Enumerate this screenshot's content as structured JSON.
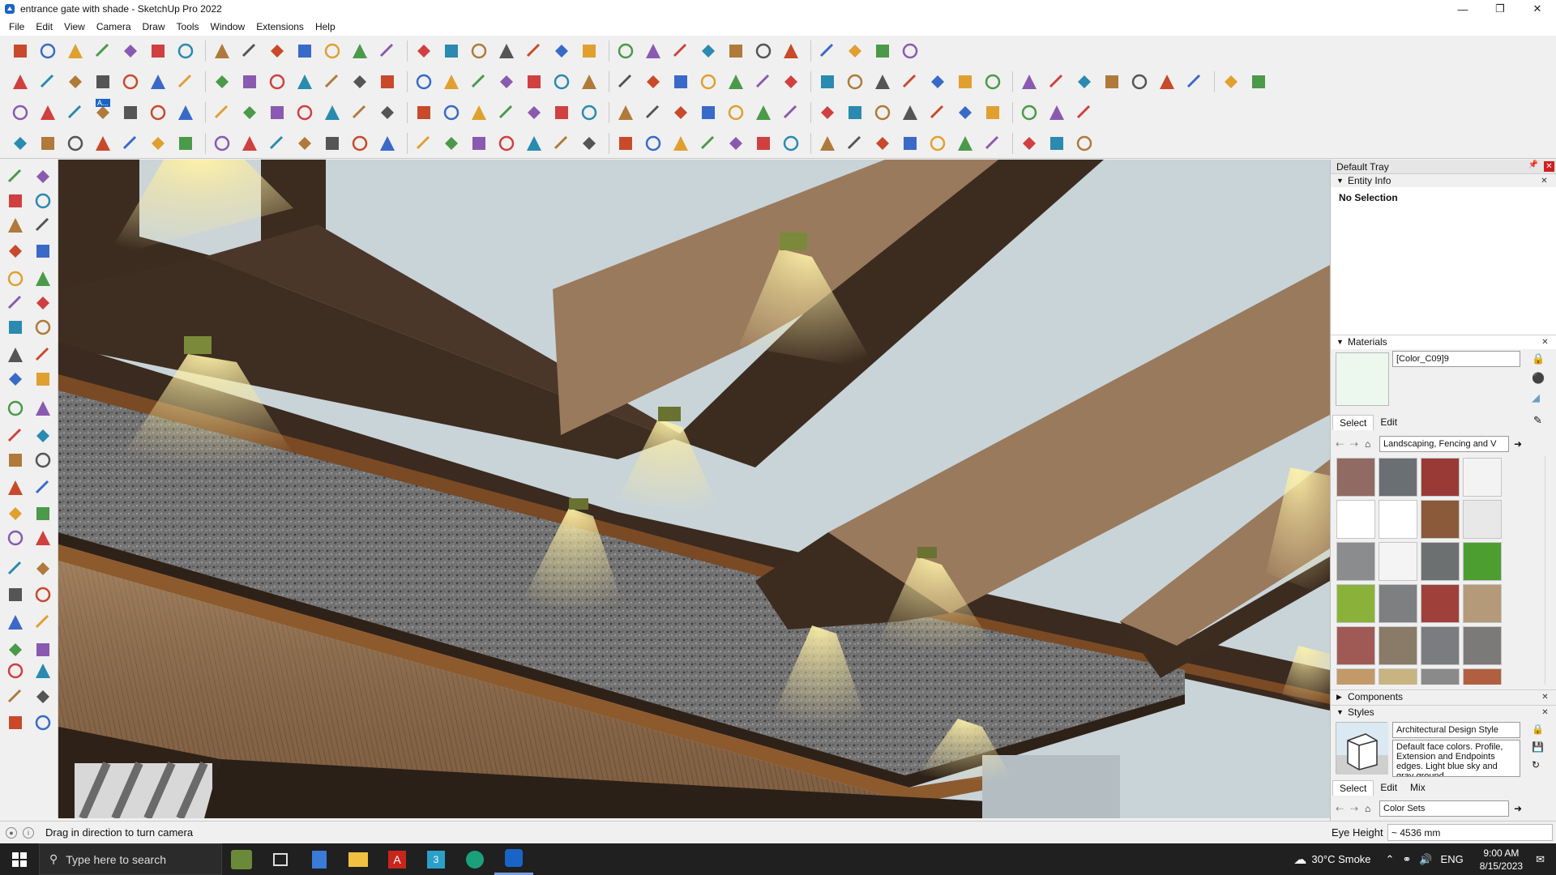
{
  "window": {
    "title": "entrance gate with shade - SketchUp Pro 2022",
    "minimize_icon": "minimize-icon",
    "maximize_icon": "restore-icon",
    "close_icon": "close-icon"
  },
  "menu": [
    "File",
    "Edit",
    "View",
    "Camera",
    "Draw",
    "Tools",
    "Window",
    "Extensions",
    "Help"
  ],
  "toolbar": {
    "text_tool_badge": "A..."
  },
  "tray": {
    "title": "Default Tray",
    "entity_info": {
      "header": "Entity Info",
      "body": "No Selection"
    },
    "materials": {
      "header": "Materials",
      "name": "[Color_C09]9",
      "swatch_color": "#ecf7ee",
      "tabs": [
        "Select",
        "Edit"
      ],
      "active_tab": "Select",
      "collection": "Landscaping, Fencing and V",
      "swatches": [
        "#8f6b63",
        "#6b6e72",
        "#9a3a36",
        "#f3f3f3",
        "#ffffff",
        "#ffffff",
        "#8a5a3a",
        "#e8e8e8",
        "#8a8c8e",
        "#f4f4f4",
        "#6d7070",
        "#4c9e30",
        "#8ab23a",
        "#7d7f80",
        "#a0403a",
        "#b49a78",
        "#a05a55",
        "#8a7a68",
        "#7a7c80",
        "#7c7a78",
        "#c29a6a",
        "#c8b480",
        "#8a8a8a",
        "#b06040"
      ]
    },
    "components": {
      "header": "Components"
    },
    "styles": {
      "header": "Styles",
      "name": "Architectural Design Style",
      "description": "Default face colors. Profile, Extension and Endpoints edges. Light blue sky and gray ground.",
      "tabs": [
        "Select",
        "Edit",
        "Mix"
      ],
      "active_tab": "Select",
      "collection": "Color Sets"
    }
  },
  "status": {
    "message": "Drag in direction to turn camera",
    "vcb_label": "Eye Height",
    "vcb_value": "~ 4536 mm"
  },
  "taskbar": {
    "search_placeholder": "Type here to search",
    "weather": "30°C  Smoke",
    "language": "ENG",
    "time": "9:00 AM",
    "date": "8/15/2023"
  },
  "colors": {
    "sky": "#c9d4d8",
    "beam_dark": "#3e2d21",
    "beam_light": "#9a7a5c",
    "light_glow": "#f6d65a",
    "granite": "#6a6a6a",
    "ceiling_wood": "#8e6c4c"
  }
}
